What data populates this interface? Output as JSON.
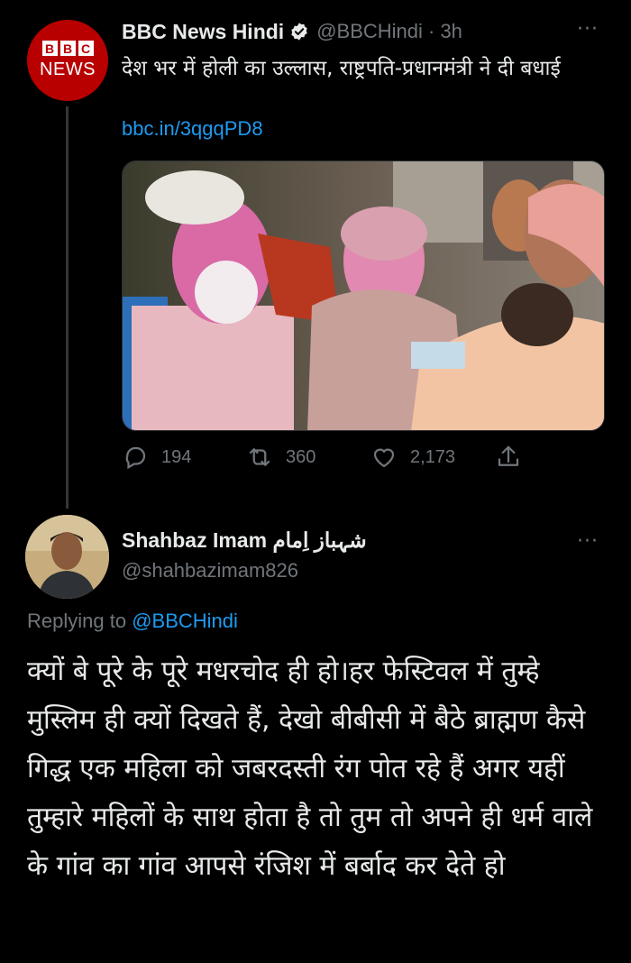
{
  "tweet": {
    "author_name": "BBC News Hindi",
    "handle_time": "@BBCHindi · 3h",
    "text": "देश भर में होली का उल्लास, राष्ट्रपति-प्रधानमंत्री ने दी बधाई",
    "link": "bbc.in/3qgqPD8",
    "avatar": {
      "boxes": [
        "B",
        "B",
        "C"
      ],
      "word": "NEWS"
    },
    "more": "···",
    "stats": {
      "replies": "194",
      "retweets": "360",
      "likes": "2,173"
    }
  },
  "reply": {
    "author_name": "Shahbaz Imam شہباز اِمام",
    "handle": "@shahbazimam826",
    "replying_label": "Replying to",
    "replying_to": "@BBCHindi",
    "more": "···",
    "text": "क्यों बे पूरे के पूरे मधरचोद ही हो।हर फेस्टिवल में तुम्हे मुस्लिम ही क्यों दिखते हैं, देखो बीबीसी में बैठे ब्राह्मण कैसे गिद्ध एक महिला को जबरदस्ती रंग पोत रहे हैं अगर यहीं तुम्हारे महिलों के साथ होता है तो तुम तो अपने ही धर्म वाले के गांव का गांव आपसे रंजिश में बर्बाद कर देते हो"
  },
  "colors": {
    "background": "#000000",
    "text": "#e7e9ea",
    "muted": "#71767b",
    "link": "#1d9bf0",
    "bbc_red": "#b80000"
  }
}
